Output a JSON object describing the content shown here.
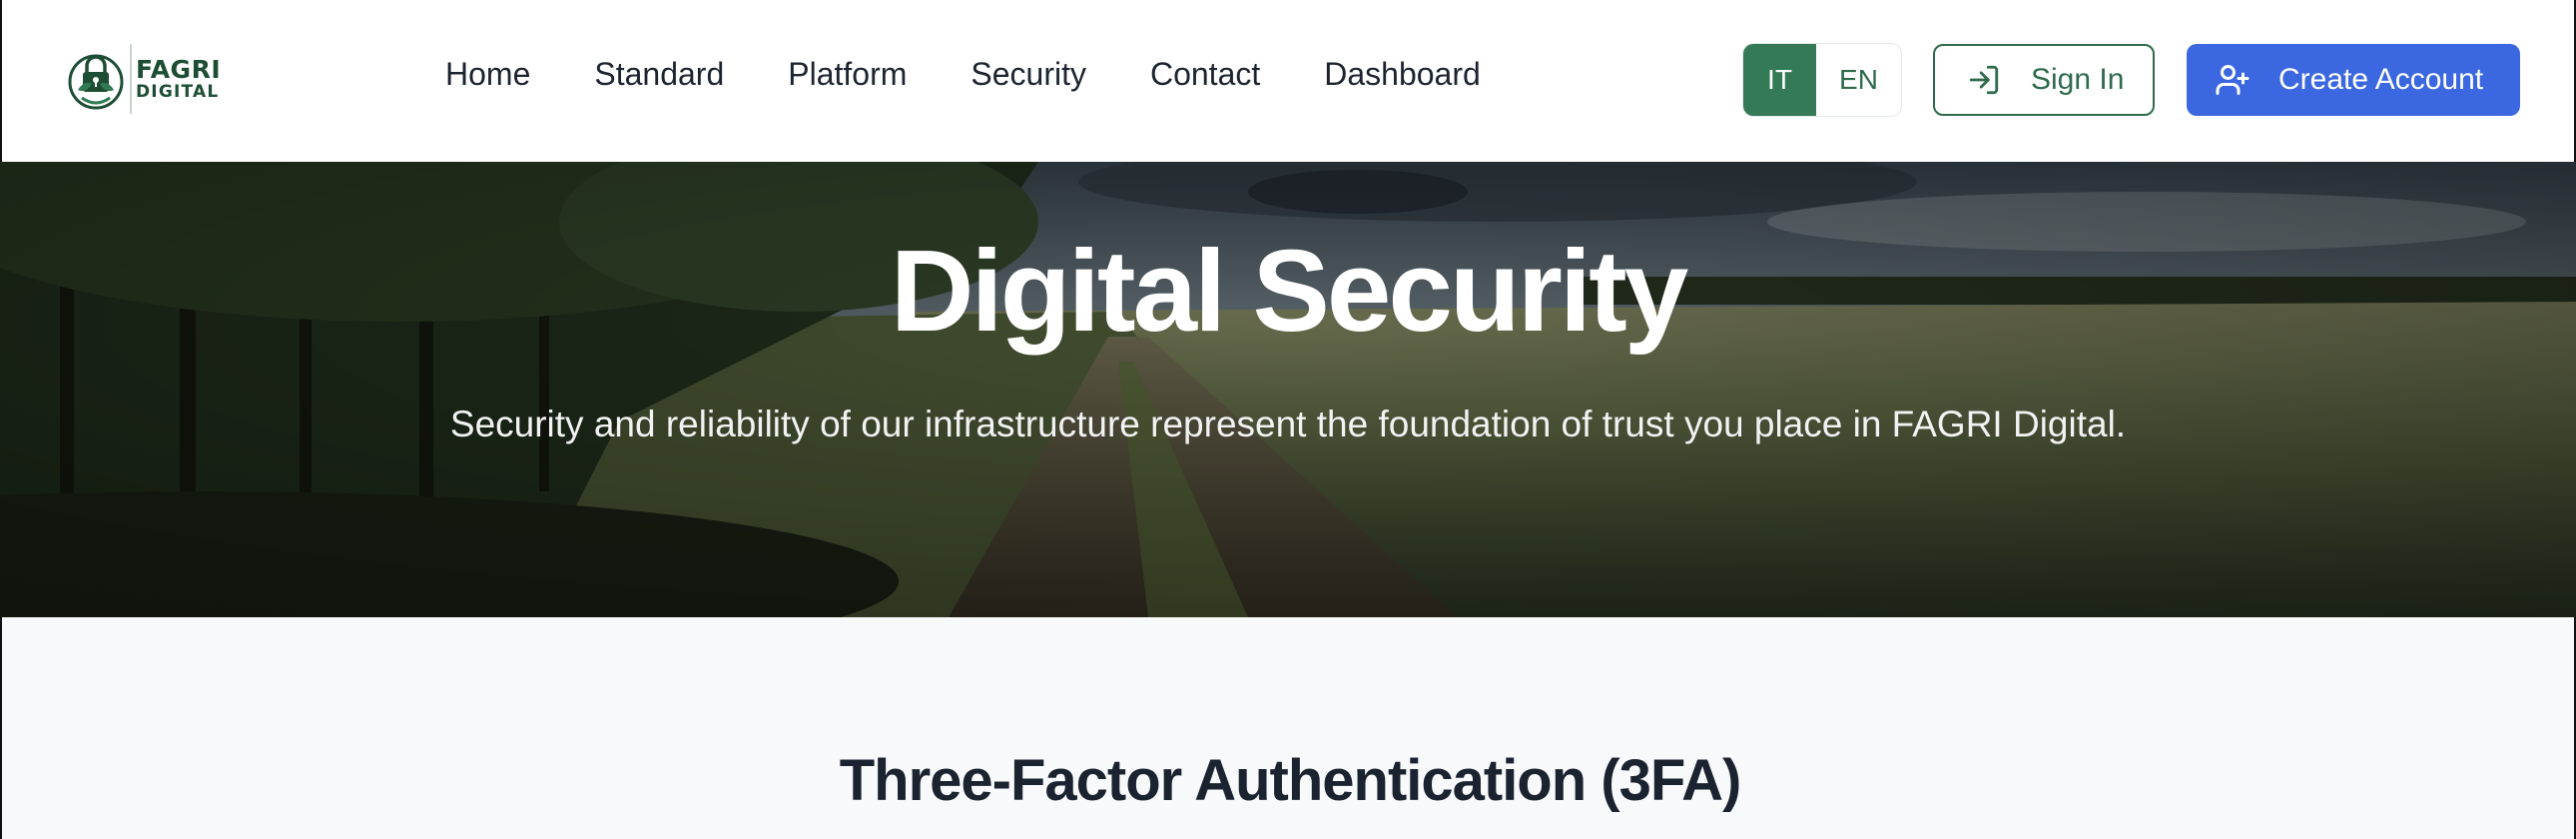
{
  "brand": {
    "line1": "FAGRI",
    "line2": "DIGITAL"
  },
  "nav": {
    "items": [
      {
        "label": "Home"
      },
      {
        "label": "Standard"
      },
      {
        "label": "Platform"
      },
      {
        "label": "Security"
      },
      {
        "label": "Contact"
      },
      {
        "label": "Dashboard"
      }
    ]
  },
  "language": {
    "options": [
      "IT",
      "EN"
    ],
    "active": "IT"
  },
  "actions": {
    "sign_in": "Sign In",
    "create_account": "Create Account"
  },
  "hero": {
    "title": "Digital Security",
    "subtitle": "Security and reliability of our infrastructure represent the foundation of trust you place in FAGRI Digital."
  },
  "section": {
    "title": "Three-Factor Authentication (3FA)"
  },
  "icons": {
    "logo": "lock-leaf-emblem-icon",
    "sign_in": "sign-in-icon",
    "create_account": "user-plus-icon"
  },
  "colors": {
    "brand_green": "#2f6a4d",
    "active_lang_bg": "#357a57",
    "primary_blue": "#3b68e0"
  }
}
